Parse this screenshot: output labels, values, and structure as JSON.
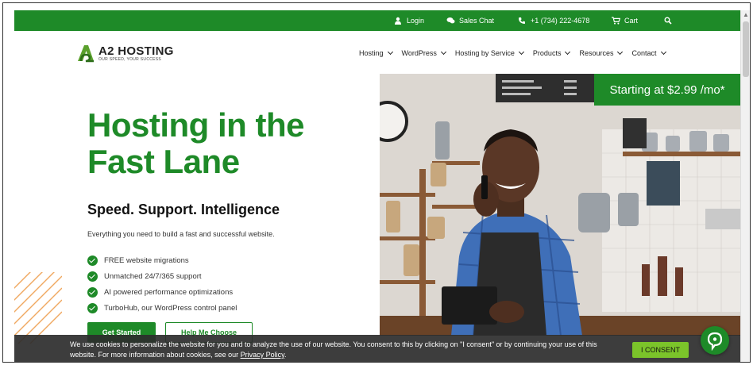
{
  "topbar": {
    "items": [
      {
        "icon": "user-icon",
        "label": "Login"
      },
      {
        "icon": "chat-icon",
        "label": "Sales Chat"
      },
      {
        "icon": "phone-icon",
        "label": "+1 (734) 222-4678"
      },
      {
        "icon": "cart-icon",
        "label": "Cart"
      },
      {
        "icon": "search-icon",
        "label": ""
      }
    ]
  },
  "logo": {
    "brand": "A2 HOSTING",
    "tagline": "OUR SPEED, YOUR SUCCESS"
  },
  "nav": {
    "items": [
      "Hosting",
      "WordPress",
      "Hosting by Service",
      "Products",
      "Resources",
      "Contact"
    ]
  },
  "hero": {
    "title_line1": "Hosting in the",
    "title_line2": "Fast Lane",
    "subtitle": "Speed. Support. Intelligence",
    "description": "Everything you need to build a fast and successful website.",
    "features": [
      "FREE website migrations",
      "Unmatched 24/7/365 support",
      "AI powered performance optimizations",
      "TurboHub, our WordPress control panel"
    ],
    "primary_button": "Get Started",
    "secondary_button": "Help Me Choose"
  },
  "promo": {
    "label": "Starting at $2.99 /mo*"
  },
  "cookie": {
    "text_before_link": "We use cookies to personalize the website for you and to analyze the use of our website. You consent to this by clicking on \"I consent\" or by continuing your use of this website. For more information about cookies, see our ",
    "link": "Privacy Policy",
    "text_after_link": ".",
    "button": "I CONSENT"
  },
  "colors": {
    "brand_green": "#1e8a28",
    "consent_green": "#7bc42a",
    "cookie_bar": "#2d2d2d"
  }
}
